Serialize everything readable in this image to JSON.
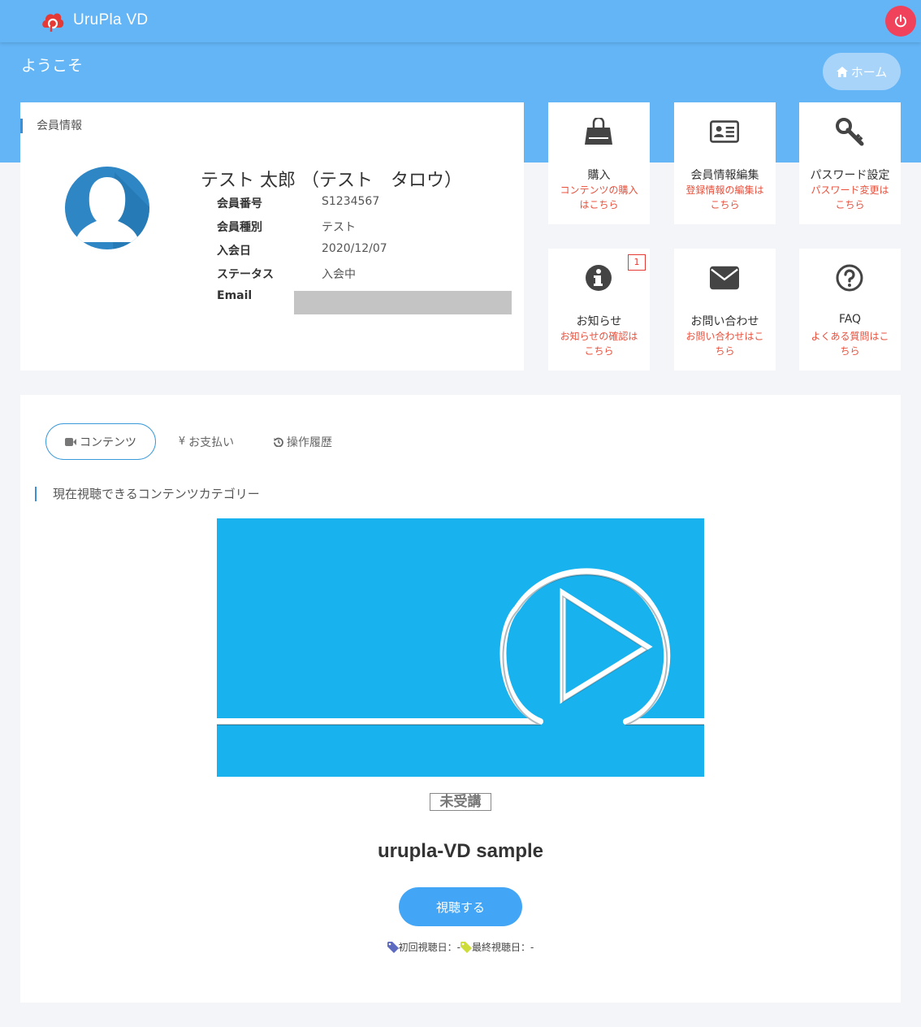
{
  "header": {
    "app_name": "UruPla VD",
    "welcome": "ようこそ",
    "home_label": "ホーム"
  },
  "member": {
    "section_title": "会員情報",
    "name": "テスト 太郎 （テスト　タロウ）",
    "fields": [
      {
        "label": "会員番号",
        "value": "S1234567"
      },
      {
        "label": "会員種別",
        "value": "テスト"
      },
      {
        "label": "入会日",
        "value": "2020/12/07"
      },
      {
        "label": "ステータス",
        "value": "入会中"
      },
      {
        "label": "Email",
        "value": ""
      }
    ]
  },
  "menu": {
    "tiles": [
      {
        "title": "購入",
        "subtitle": "コンテンツの購入はこちら",
        "icon": "shopping-bag-icon"
      },
      {
        "title": "会員情報編集",
        "subtitle": "登録情報の編集はこちら",
        "icon": "id-card-icon"
      },
      {
        "title": "パスワード設定",
        "subtitle": "パスワード変更はこちら",
        "icon": "key-icon"
      },
      {
        "title": "お知らせ",
        "subtitle": "お知らせの確認はこちら",
        "icon": "info-icon",
        "badge": "1"
      },
      {
        "title": "お問い合わせ",
        "subtitle": "お問い合わせはこちら",
        "icon": "envelope-icon"
      },
      {
        "title": "FAQ",
        "subtitle": "よくある質問はこちら",
        "icon": "question-icon"
      }
    ]
  },
  "tabs": [
    {
      "label": "コンテンツ",
      "icon": "video-camera-icon",
      "active": true
    },
    {
      "label": "お支払い",
      "icon": "yen-icon",
      "active": false
    },
    {
      "label": "操作履歴",
      "icon": "history-icon",
      "active": false
    }
  ],
  "content": {
    "section_title": "現在視聴できるコンテンツカテゴリー",
    "status": "未受講",
    "title": "urupla-VD sample",
    "watch_label": "視聴する",
    "first_view": "初回視聴日：-",
    "last_view": "最終視聴日：-"
  },
  "colors": {
    "header_bg": "#64b5f6",
    "power_button": "#f0425a",
    "accent": "#42a5f5",
    "link_red": "#e8503c",
    "thumbnail_bg": "#18b3ee",
    "first_tag": "#5c6bc0",
    "last_tag": "#cddc39"
  }
}
